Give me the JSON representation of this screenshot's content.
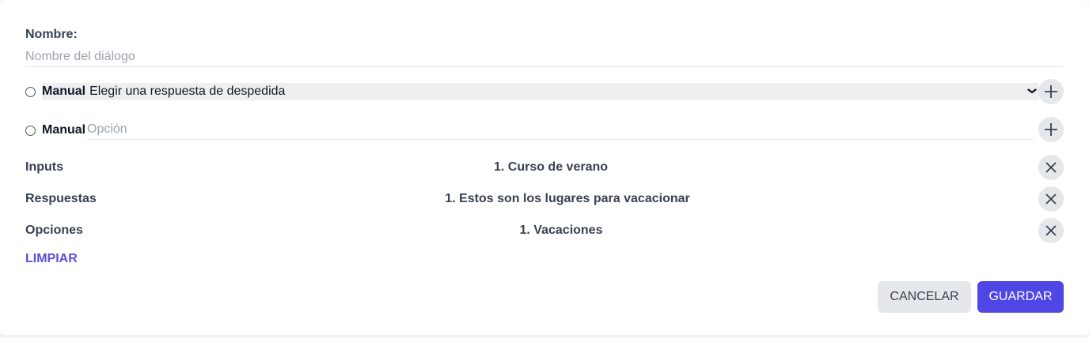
{
  "form": {
    "name_label": "Nombre:",
    "name_placeholder": "Nombre del diálogo",
    "name_value": ""
  },
  "farewell": {
    "radio_label": "Manual",
    "select_value": "Elegir una respuesta de despedida",
    "add_icon": "plus-icon"
  },
  "option": {
    "radio_label": "Manual",
    "placeholder": "Opción",
    "add_icon": "plus-icon"
  },
  "lists": [
    {
      "label": "Inputs",
      "value": "1. Curso de verano",
      "remove_icon": "close-icon"
    },
    {
      "label": "Respuestas",
      "value": "1. Estos son los lugares para vacacionar",
      "remove_icon": "close-icon"
    },
    {
      "label": "Opciones",
      "value": "1. Vacaciones",
      "remove_icon": "close-icon"
    }
  ],
  "actions": {
    "clear_label": "LIMPIAR",
    "cancel_label": "CANCELAR",
    "save_label": "GUARDAR"
  },
  "colors": {
    "accent": "#4f46e5",
    "link": "#5b4fd8",
    "button_gray": "#e5e7eb"
  }
}
